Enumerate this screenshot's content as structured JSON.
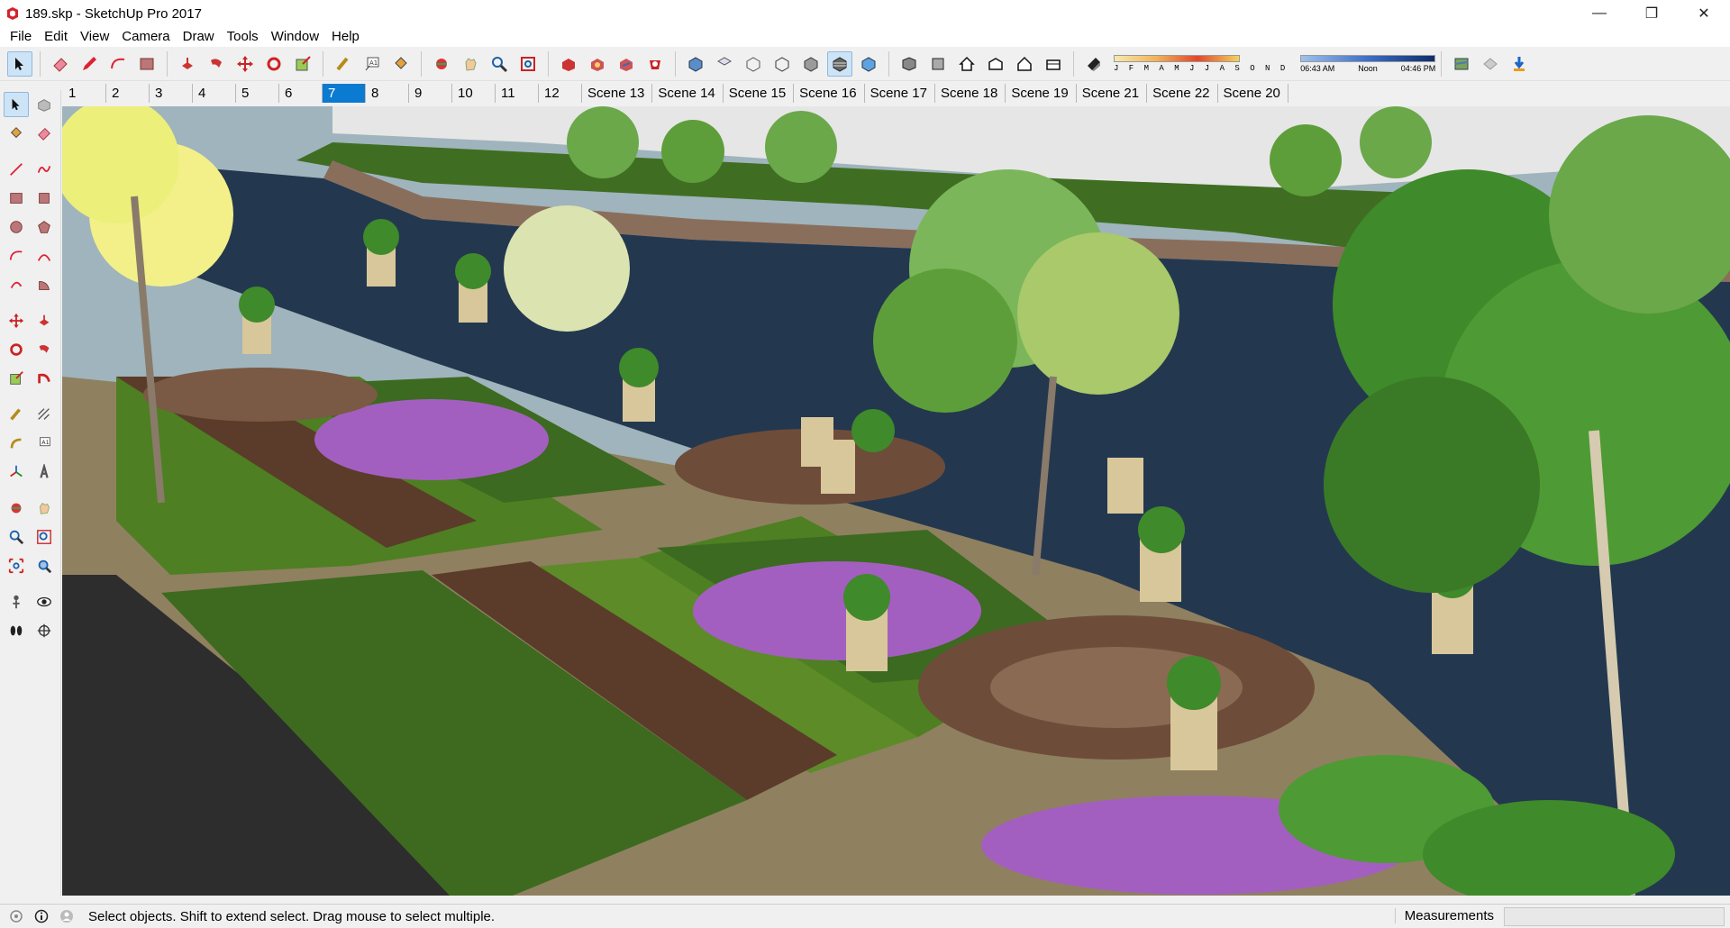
{
  "window": {
    "title": "189.skp - SketchUp Pro 2017",
    "minimize": "—",
    "restore": "❐",
    "close": "✕"
  },
  "menu": [
    "File",
    "Edit",
    "View",
    "Camera",
    "Draw",
    "Tools",
    "Window",
    "Help"
  ],
  "toolbar": {
    "shadow_months": "J F M A M J J A S O N D",
    "time_start": "06:43 AM",
    "time_mid": "Noon",
    "time_end": "04:46 PM"
  },
  "scene_tabs": [
    "1",
    "2",
    "3",
    "4",
    "5",
    "6",
    "7",
    "8",
    "9",
    "10",
    "11",
    "12",
    "Scene 13",
    "Scene 14",
    "Scene 15",
    "Scene 16",
    "Scene 17",
    "Scene 18",
    "Scene 19",
    "Scene 21",
    "Scene 22",
    "Scene 20"
  ],
  "active_tab": "7",
  "status": {
    "hint": "Select objects. Shift to extend select. Drag mouse to select multiple.",
    "measurements_label": "Measurements",
    "measurements_value": ""
  },
  "colors": {
    "accent": "#0b7ad1",
    "water": "#23384f",
    "lawn": "#4f7a22",
    "paving": "#9a8a66"
  }
}
